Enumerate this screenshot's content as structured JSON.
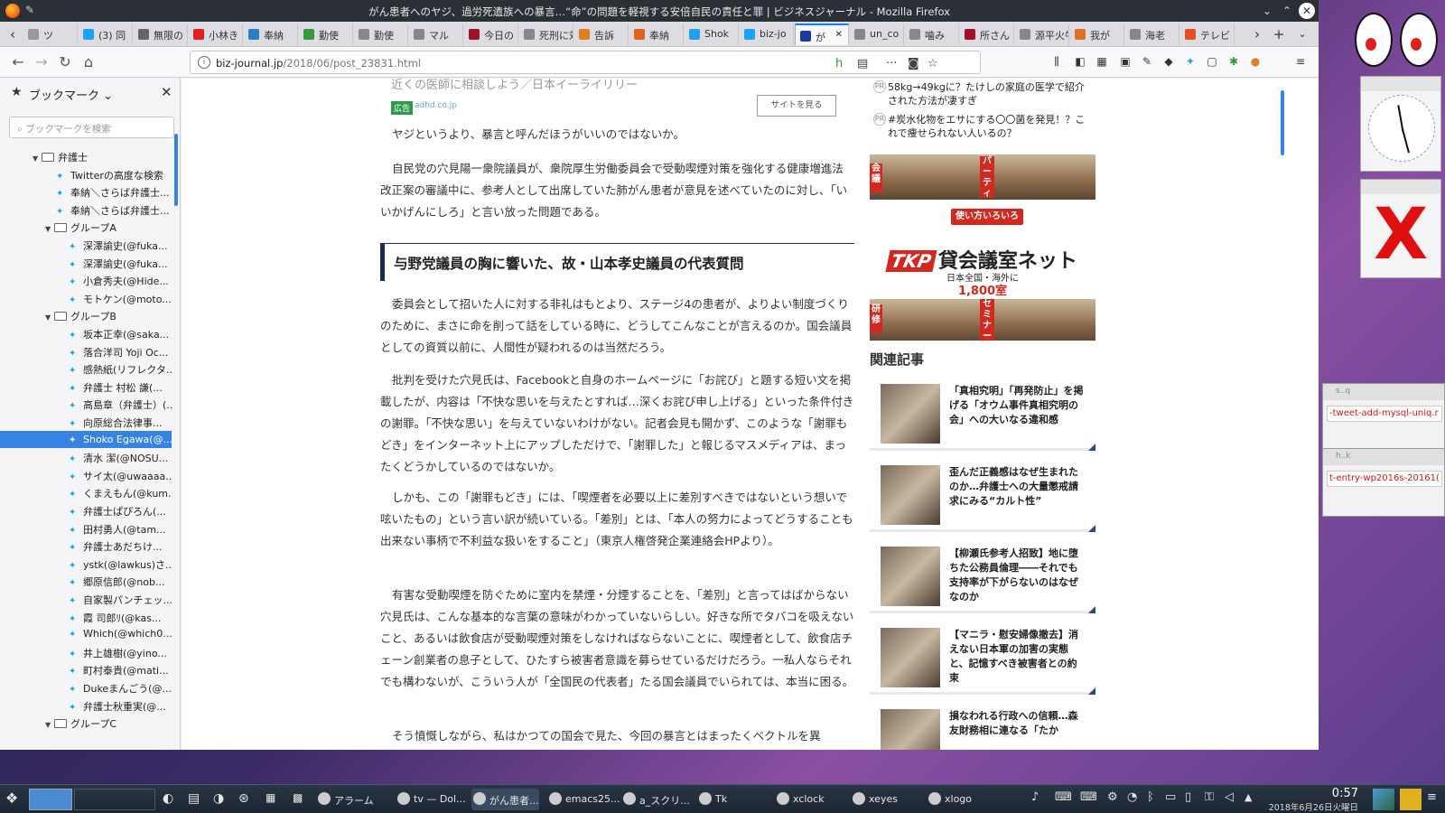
{
  "window": {
    "title": "がん患者へのヤジ、過労死遺族への暴言…“命”の問題を軽視する安倍自民の責任と罪 | ビジネスジャーナル - Mozilla Firefox"
  },
  "tabs": [
    {
      "label": "ツ",
      "color": "#999"
    },
    {
      "label": "(3) 同",
      "color": "#1da1f2"
    },
    {
      "label": "無限の",
      "color": "#666"
    },
    {
      "label": "小林き",
      "color": "#e02020"
    },
    {
      "label": "奉納",
      "color": "#2a80c8"
    },
    {
      "label": "勤使",
      "color": "#3a9a3a"
    },
    {
      "label": "勤使",
      "color": "#888"
    },
    {
      "label": "マル",
      "color": "#888"
    },
    {
      "label": "今日の",
      "color": "#a0102a"
    },
    {
      "label": "死刑に対",
      "color": "#888"
    },
    {
      "label": "告訴",
      "color": "#e08020"
    },
    {
      "label": "奉納",
      "color": "#e06020"
    },
    {
      "label": "Shok",
      "color": "#1da1f2"
    },
    {
      "label": "biz-jo",
      "color": "#1da1f2"
    },
    {
      "label": "が",
      "color": "#1a3aa0"
    },
    {
      "label": "un_co",
      "color": "#888"
    },
    {
      "label": "噛み",
      "color": "#888"
    },
    {
      "label": "所さん",
      "color": "#a0102a"
    },
    {
      "label": "源平火牛",
      "color": "#888"
    },
    {
      "label": "我が",
      "color": "#e07020"
    },
    {
      "label": "海老",
      "color": "#888"
    },
    {
      "label": "テレビ",
      "color": "#e05020"
    }
  ],
  "nav": {
    "url_host": "biz-journal.jp",
    "url_path": "/2018/06/post_23831.html"
  },
  "sidebar": {
    "title": "ブックマーク",
    "search_placeholder": "ブックマークを検索",
    "tree": [
      {
        "label": "弁護士",
        "type": "folder",
        "depth": 0
      },
      {
        "label": "Twitterの高度な検索",
        "type": "bm",
        "depth": 1
      },
      {
        "label": "奉納＼さらば弁護士...",
        "type": "bm",
        "depth": 1
      },
      {
        "label": "奉納＼さらば弁護士...",
        "type": "bm",
        "depth": 1
      },
      {
        "label": "グループA",
        "type": "folder",
        "depth": 1
      },
      {
        "label": "深澤諭史(@fuka...",
        "type": "bm",
        "depth": 2
      },
      {
        "label": "深澤諭史(@fuka...",
        "type": "bm",
        "depth": 2
      },
      {
        "label": "小倉秀夫(@Hide...",
        "type": "bm",
        "depth": 2
      },
      {
        "label": "モトケン(@moto...",
        "type": "bm",
        "depth": 2
      },
      {
        "label": "グループB",
        "type": "folder",
        "depth": 1
      },
      {
        "label": "坂本正幸(@saka...",
        "type": "bm",
        "depth": 2
      },
      {
        "label": "落合洋司 Yoji Oc...",
        "type": "bm",
        "depth": 2
      },
      {
        "label": "感熱紙(リフレクタ...",
        "type": "bm",
        "depth": 2
      },
      {
        "label": "弁護士 村松 謙(...",
        "type": "bm",
        "depth": 2
      },
      {
        "label": "高島章（弁護士）(...",
        "type": "bm",
        "depth": 2
      },
      {
        "label": "向原総合法律事...",
        "type": "bm",
        "depth": 2
      },
      {
        "label": "Shoko Egawa(@...",
        "type": "bm",
        "depth": 2,
        "selected": true
      },
      {
        "label": "清水 潔(@NOSU...",
        "type": "bm",
        "depth": 2
      },
      {
        "label": "サイ太(@uwaaaa...",
        "type": "bm",
        "depth": 2
      },
      {
        "label": "くまえもん(@kum...",
        "type": "bm",
        "depth": 2
      },
      {
        "label": "弁護士ぱぴろん(...",
        "type": "bm",
        "depth": 2
      },
      {
        "label": "田村勇人(@tam...",
        "type": "bm",
        "depth": 2
      },
      {
        "label": "弁護士あだちけ...",
        "type": "bm",
        "depth": 2
      },
      {
        "label": "ystk(@lawkus)さ...",
        "type": "bm",
        "depth": 2
      },
      {
        "label": "郷原信郎(@nob...",
        "type": "bm",
        "depth": 2
      },
      {
        "label": "自家製パンチェッ...",
        "type": "bm",
        "depth": 2
      },
      {
        "label": "霞 司郎ﾘ(@kas...",
        "type": "bm",
        "depth": 2
      },
      {
        "label": "Which(@which0...",
        "type": "bm",
        "depth": 2
      },
      {
        "label": "井上雄樹(@yino...",
        "type": "bm",
        "depth": 2
      },
      {
        "label": "町村泰貴(@mati...",
        "type": "bm",
        "depth": 2
      },
      {
        "label": "Dukeまんごう(@...",
        "type": "bm",
        "depth": 2
      },
      {
        "label": "弁護士秋重実(@...",
        "type": "bm",
        "depth": 2
      },
      {
        "label": "グループC",
        "type": "folder",
        "depth": 1
      }
    ]
  },
  "article": {
    "ad_line": "近くの医師に相談しよう／日本イーライリリー",
    "ad_badge": "広告",
    "ad_domain": "adhd.co.jp",
    "ad_button": "サイトを見る",
    "p1": "ヤジというより、暴言と呼んだほうがいいのではないか。",
    "p2": "自民党の穴見陽一衆院議員が、衆院厚生労働委員会で受動喫煙対策を強化する健康増進法改正案の審議中に、参考人として出席していた肺がん患者が意見を述べていたのに対し、「いいかげんにしろ」と言い放った問題である。",
    "h2": "与野党議員の胸に響いた、故・山本孝史議員の代表質問",
    "p3": "委員会として招いた人に対する非礼はもとより、ステージ4の患者が、よりよい制度づくりのために、まさに命を削って話をしている時に、どうしてこんなことが言えるのか。国会議員としての資質以前に、人間性が疑われるのは当然だろう。",
    "p4": "批判を受けた穴見氏は、Facebookと自身のホームページに「お詫び」と題する短い文を掲載したが、内容は「不快な思いを与えたとすれば…深くお詫び申し上げる」といった条件付きの謝罪。「不快な思い」を与えていないわけがない。記者会見も開かず、このような「謝罪もどき」をインターネット上にアップしただけで、「謝罪した」と報じるマスメディアは、まったくどうかしているのではないか。",
    "p5": "しかも、この「謝罪もどき」には、「喫煙者を必要以上に差別すべきではないという想いで呟いたもの」という言い訳が続いている。「差別」とは、「本人の努力によってどうすることも出来ない事柄で不利益な扱いをすること」（東京人権啓発企業連絡会HPより）。",
    "p6": "有害な受動喫煙を防ぐために室内を禁煙・分煙することを、「差別」と言ってはばからない穴見氏は、こんな基本的な言葉の意味がわかっていないらしい。好きな所でタバコを吸えないこと、あるいは飲食店が受動喫煙対策をしなければならないことに、喫煙者として、飲食店チェーン創業者の息子として、ひたすら被害者意識を募らせているだけだろう。一私人ならそれでも構わないが、こういう人が「全国民の代表者」たる国会議員でいられては、本当に困る。",
    "p7": "そう憤慨しながら、私はかつての国会で見た、今回の暴言とはまったくベクトルを異"
  },
  "rightcol": {
    "pr_badge": "PR",
    "pr1": "58kg→49kgに？たけしの家庭の医学で紹介された方法が凄すぎ",
    "pr2": "#炭水化物をエサにする〇〇菌を発見！？これで痩せられない人いるの？",
    "ad_tags": [
      "会議",
      "パーティ",
      "研修",
      "セミナー"
    ],
    "ad_catch": "使い方いろいろ",
    "ad_logo": "TKP",
    "ad_name": "貸会議室ネット",
    "ad_sub": "日本全国・海外に",
    "ad_count": "1,800室",
    "related_title": "関連記事",
    "related": [
      "「真相究明」「再発防止」を掲げる「オウム事件真相究明の会」への大いなる違和感",
      "歪んだ正義感はなぜ生まれたのか…弁護士への大量懲戒請求にみる“カルト性”",
      "【柳瀬氏参考人招致】地に堕ちた公務員倫理――それでも支持率が下がらないのはなぜなのか",
      "【マニラ・慰安婦像撤去】消えない日本軍の加害の実態と、記憶すべき被害者との約束",
      "損なわれる行政への信頼…森友財務相に連なる「たか"
    ]
  },
  "terms": [
    "-tweet-add-mysql-uniq.r",
    "t-entry-wp2016s-20161("
  ],
  "term_titles": [
    "s..q",
    "h..k"
  ],
  "taskbar": {
    "items": [
      "アラーム",
      "tv — Dol...",
      "がん患者...",
      "emacs25...",
      "a_スクリ...",
      "Tk",
      "xclock",
      "xeyes",
      "xlogo"
    ],
    "time": "0:57",
    "date": "2018年6月26日火曜日"
  }
}
